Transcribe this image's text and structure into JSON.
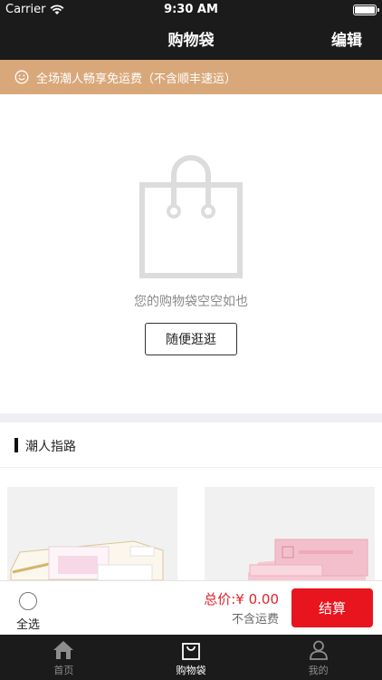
{
  "status_bar": {
    "carrier": "Carrier",
    "time": "9:30 AM"
  },
  "nav": {
    "title": "购物袋",
    "edit_label": "编辑"
  },
  "notice": {
    "text": "全场潮人畅享免运费（不含顺丰速运）"
  },
  "empty_state": {
    "message": "您的购物袋空空如也",
    "button_label": "随便逛逛"
  },
  "section": {
    "title": "潮人指路"
  },
  "checkout": {
    "select_all_label": "全选",
    "total_label": "总价:",
    "total_value": "¥ 0.00",
    "shipping_note": "不含运费",
    "pay_button_label": "结算"
  },
  "tabs": [
    {
      "label": "首页",
      "icon": "home-icon",
      "active": false
    },
    {
      "label": "购物袋",
      "icon": "bag-icon",
      "active": true
    },
    {
      "label": "我的",
      "icon": "user-icon",
      "active": false
    }
  ],
  "colors": {
    "header_bg": "#1b1b1b",
    "notice_bg": "#d9a87a",
    "accent_red": "#e8141e",
    "price_red": "#e0242c"
  }
}
